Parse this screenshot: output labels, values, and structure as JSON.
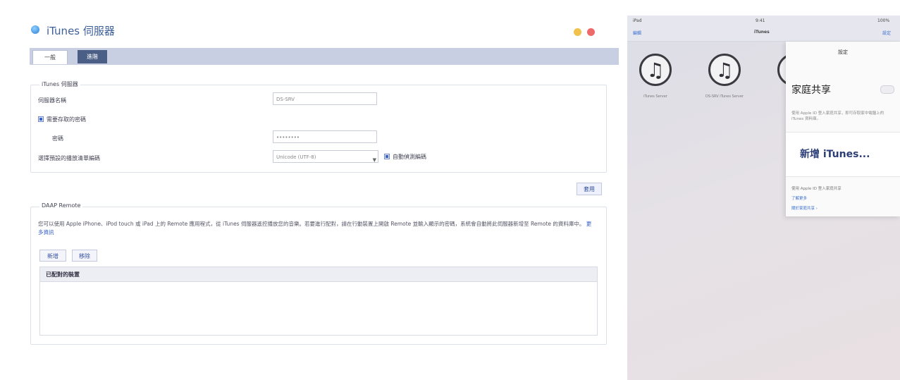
{
  "window": {
    "title": "iTunes 伺服器",
    "icon": "itunes-app-icon",
    "controls": {
      "minimize_color": "#f1c24a",
      "close_color": "#ee6a6a"
    }
  },
  "tabs": [
    {
      "label": "一般",
      "active": true
    },
    {
      "label": "進階",
      "active": false
    }
  ],
  "general_settings": {
    "legend": "iTunes 伺服器",
    "server_name_label": "伺服器名稱",
    "server_name_value": "DS-SRV",
    "require_password_label": "需要存取的密碼",
    "require_password_checked": true,
    "password_label": "密碼",
    "password_value": "••••••••",
    "encoding_label": "選擇預設的播放清單編碼",
    "encoding_value": "Unicode (UTF-8)",
    "auto_check_label": "自動偵測編碼",
    "auto_check_checked": true
  },
  "apply_button": "套用",
  "remote_section": {
    "legend": "DAAP Remote",
    "description": "您可以使用 Apple iPhone、iPod touch 或 iPad 上的 Remote 應用程式，從 iTunes 伺服器遙控播放您的音樂。若要進行配對，請在行動裝置上開啟 Remote 並輸入顯示的密碼，系統會自動將此伺服器新增至 Remote 的資料庫中。",
    "more_link": "更多資訊",
    "add_button": "新增",
    "remove_button": "移除",
    "list_header": "已配對的裝置"
  },
  "ipad": {
    "status_left": "iPad",
    "status_center": "9:41",
    "status_right": "100%",
    "nav_left": "編輯",
    "nav_center": "iTunes",
    "nav_right": "設定",
    "servers": [
      {
        "name": "iTunes Server",
        "icon": "music-note-icon"
      },
      {
        "name": "DS-SRV iTunes Server",
        "icon": "music-note-icon"
      }
    ],
    "popover": {
      "title": "設定",
      "heading": "家庭共享",
      "subtext": "使用 Apple ID 登入家庭共享，即可存取家中電腦上的 iTunes 資料庫。",
      "card_text": "新增 iTunes...",
      "foot_lines": [
        "使用 Apple ID 登入家庭共享",
        "了解更多",
        "關於家庭共享 ›"
      ]
    }
  }
}
